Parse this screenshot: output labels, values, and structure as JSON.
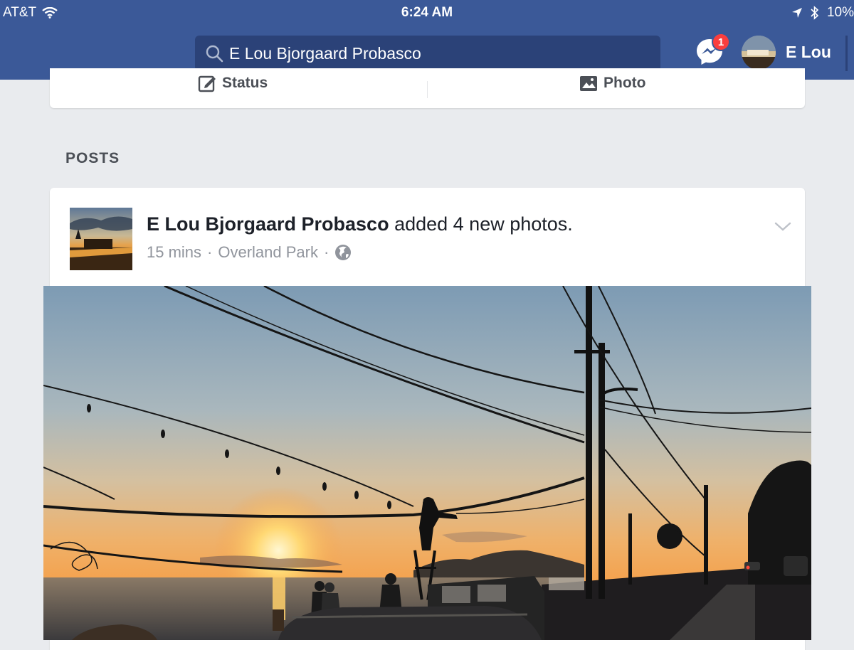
{
  "status_bar": {
    "carrier": "AT&T",
    "time": "6:24 AM",
    "battery": "10%"
  },
  "header": {
    "search_value": "E Lou Bjorgaard Probasco",
    "messenger_badge": "1",
    "profile_name": "E Lou"
  },
  "composer": {
    "status_label": "Status",
    "photo_label": "Photo"
  },
  "section": {
    "heading": "POSTS"
  },
  "post": {
    "author": "E Lou Bjorgaard Probasco",
    "action": "added 4 new photos.",
    "time": "15 mins",
    "separator": "·",
    "location": "Overland Park",
    "audience_icon": "globe-icon"
  },
  "colors": {
    "brand_blue": "#3b5998",
    "search_bg": "#2b4278",
    "badge_red": "#fa3e3e",
    "page_bg": "#e9ebee"
  }
}
